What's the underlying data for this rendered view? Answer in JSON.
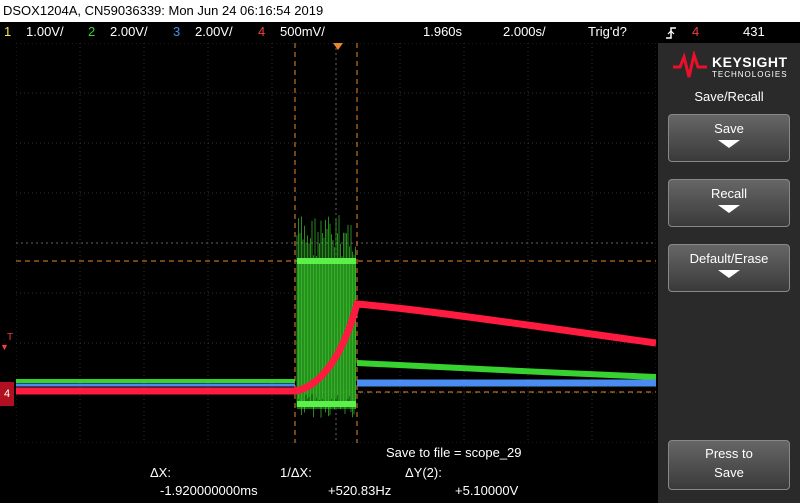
{
  "title": "DSOX1204A, CN59036339: Mon Jun 24 06:16:54 2019",
  "status": {
    "ch1": {
      "num": "1",
      "scale": "1.00V/",
      "color": "#f4e85a"
    },
    "ch2": {
      "num": "2",
      "scale": "2.00V/",
      "color": "#38d230"
    },
    "ch3": {
      "num": "3",
      "scale": "2.00V/",
      "color": "#4a8cf0"
    },
    "ch4": {
      "num": "4",
      "scale": "500mV/",
      "color": "#f04040"
    },
    "delay": "1.960s",
    "timebase": "2.000s/",
    "trig_state": "Trig'd?",
    "trig_source": "4",
    "trig_level": "431"
  },
  "panel": {
    "brand": "KEYSIGHT",
    "brand_sub": "TECHNOLOGIES",
    "menu_title": "Save/Recall",
    "save": "Save",
    "recall": "Recall",
    "default_erase": "Default/Erase",
    "press_to": "Press to",
    "press_save": "Save"
  },
  "message": "Save to file =  scope_29",
  "measurements": {
    "dx_label": "ΔX:",
    "dx_value": "-1.920000000ms",
    "inv_dx_label": "1/ΔX:",
    "inv_dx_value": "+520.83Hz",
    "dy_label": "ΔY(2):",
    "dy_value": "+5.10000V"
  },
  "markers": {
    "trigger_t": "T",
    "ch4_marker": "4"
  }
}
